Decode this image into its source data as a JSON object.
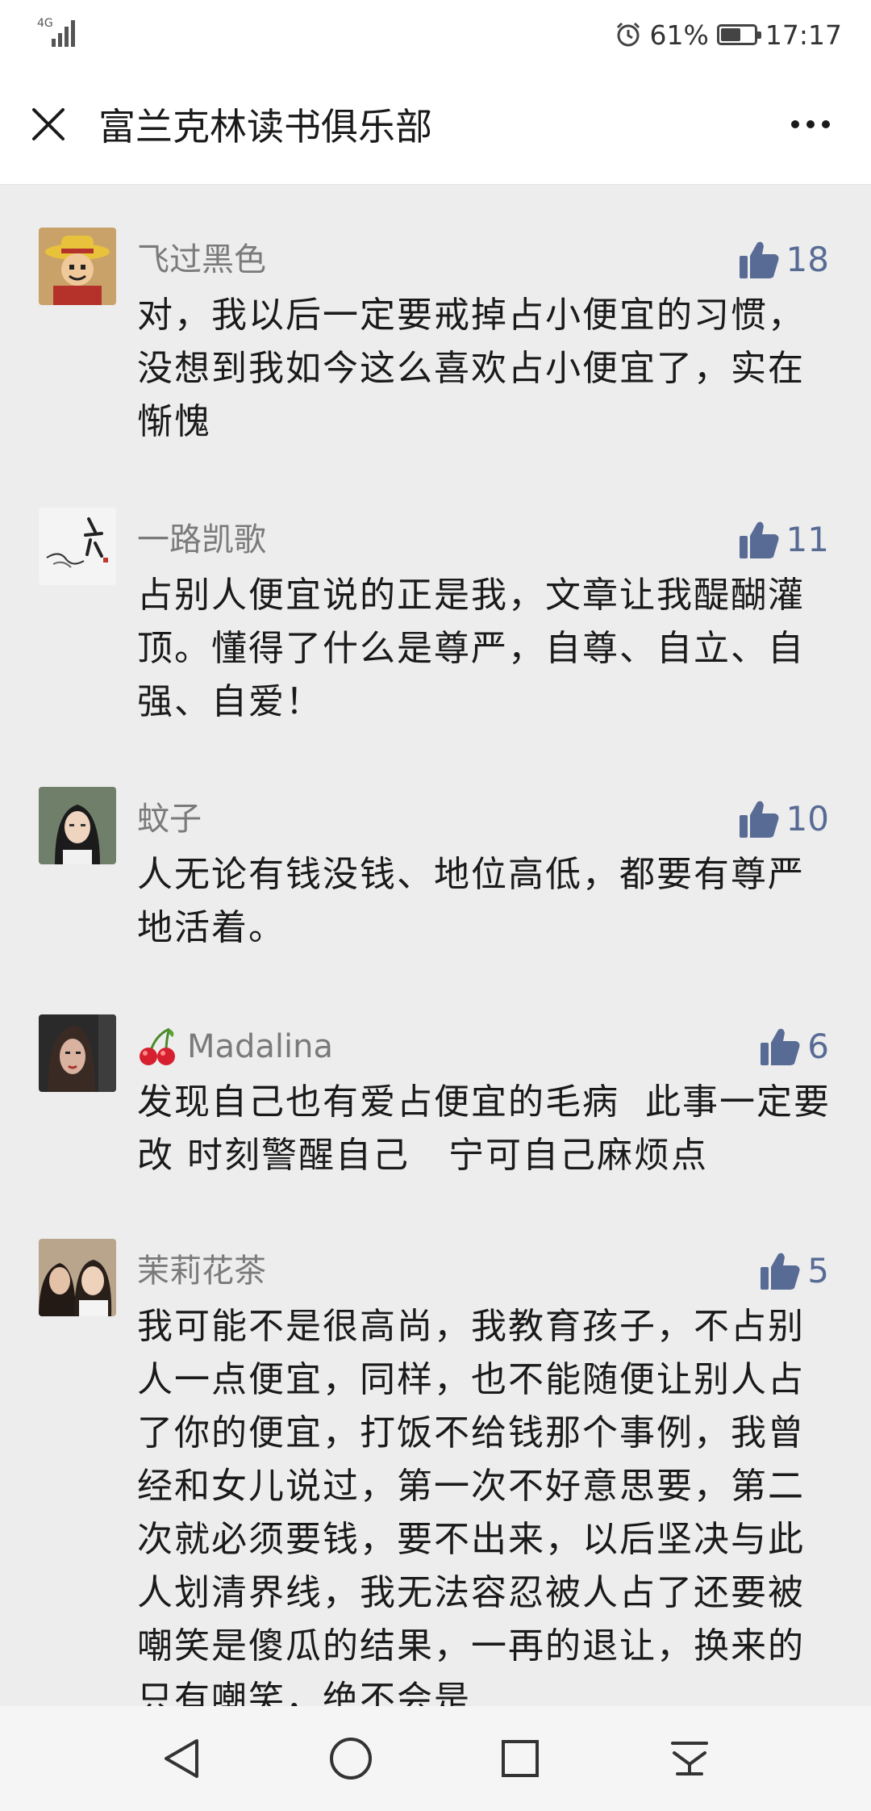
{
  "status_bar": {
    "network": "4G",
    "battery_percent": "61%",
    "battery_level": 0.61,
    "time": "17:17"
  },
  "header": {
    "title": "富兰克林读书俱乐部",
    "close_icon": "close-icon",
    "more_icon": "more-icon"
  },
  "comments": [
    {
      "name": "飞过黑色",
      "likes": "18",
      "text": "对，我以后一定要戒掉占小便宜的习惯，没想到我如今这么喜欢占小便宜了，实在惭愧"
    },
    {
      "name": "一路凯歌",
      "likes": "11",
      "text": "占别人便宜说的正是我，文章让我醍醐灌顶。懂得了什么是尊严，自尊、自立、自强、自爱！"
    },
    {
      "name": "蚊子",
      "likes": "10",
      "text": "人无论有钱没钱、地位高低，都要有尊严地活着。"
    },
    {
      "name": "Madalina",
      "name_prefix_icon": "cherry-icon",
      "likes": "6",
      "text": "发现自己也有爱占便宜的毛病  此事一定要改 时刻警醒自己   宁可自己麻烦点"
    },
    {
      "name": "茉莉花茶",
      "likes": "5",
      "text": "我可能不是很高尚，我教育孩子，不占别人一点便宜，同样，也不能随便让别人占了你的便宜，打饭不给钱那个事例，我曾经和女儿说过，第一次不好意思要，第二次就必须要钱，要不出来，以后坚决与此人划清界线，我无法容忍被人占了还要被嘲笑是傻瓜的结果，一再的退让，换来的只有嘲笑，绝不会是"
    }
  ],
  "colors": {
    "like_blue": "#586b95",
    "background": "#ededed",
    "name_gray": "#7a7a7a"
  },
  "nav_bar": {
    "icons": [
      "back-triangle-icon",
      "home-circle-icon",
      "recent-square-icon",
      "notification-pulldown-icon"
    ]
  }
}
